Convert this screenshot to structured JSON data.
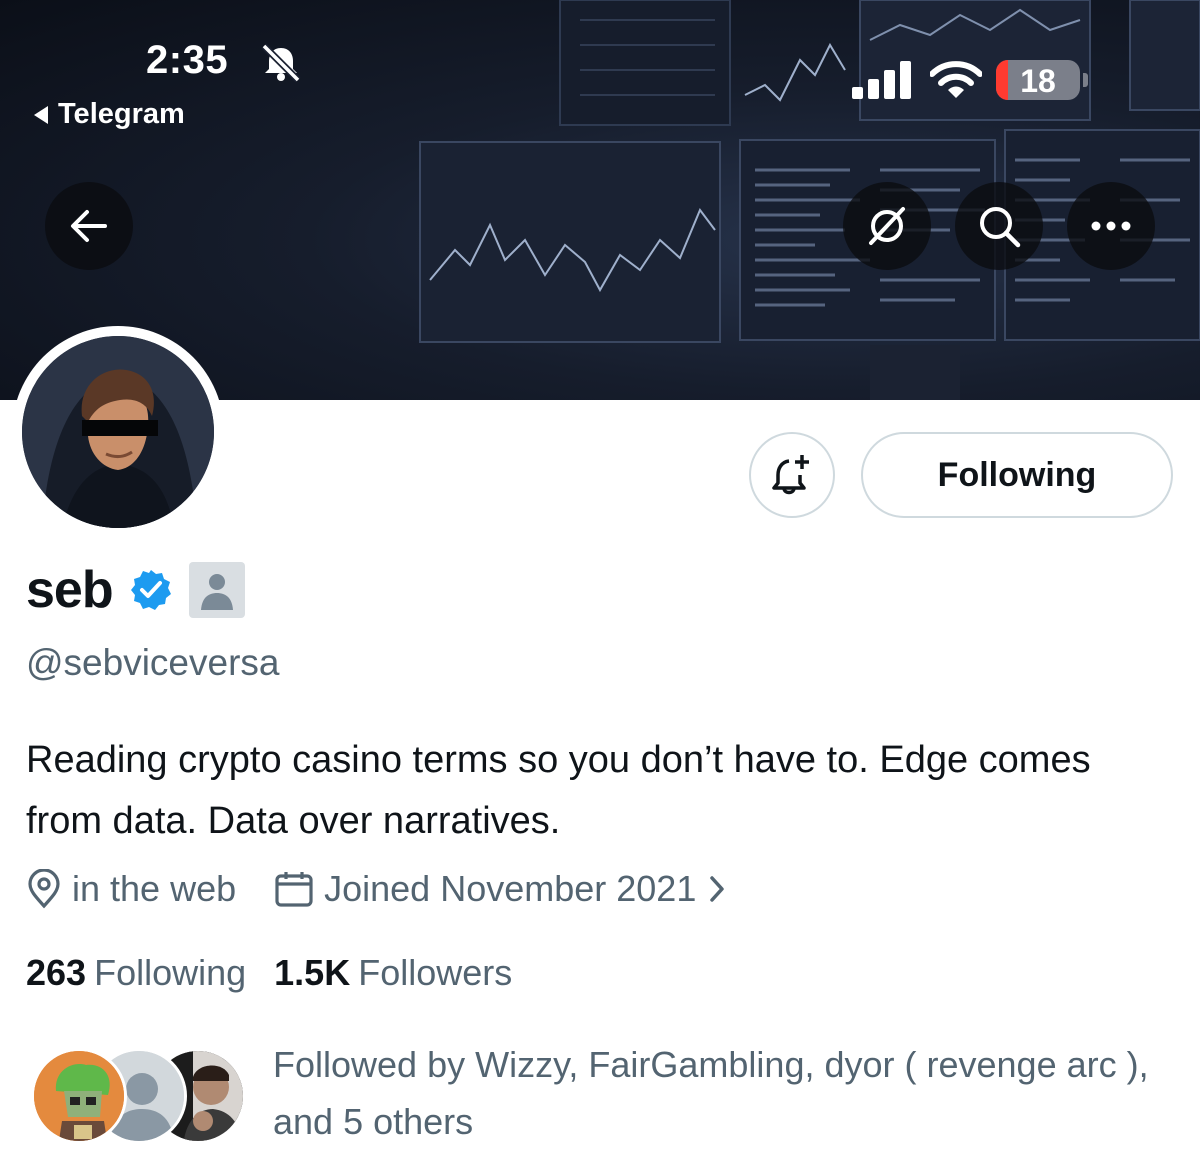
{
  "status_bar": {
    "time": "2:35",
    "back_app_label": "Telegram",
    "battery_percent": "18",
    "icons": [
      "bell-slash-icon",
      "cellular-signal-icon",
      "wifi-icon",
      "battery-icon"
    ]
  },
  "header": {
    "icons": [
      "back-arrow-icon",
      "grok-icon",
      "search-icon",
      "more-icon"
    ]
  },
  "profile": {
    "display_name": "seb",
    "handle": "@sebviceversa",
    "bio": "Reading crypto casino terms so you don’t have to. Edge comes from data. Data over narratives.",
    "location": "in the web",
    "joined": "Joined November 2021",
    "following_count": "263",
    "following_label": "Following",
    "followers_count": "1.5K",
    "followers_label": "Followers",
    "followed_by": "Followed by Wizzy, FairGambling, dyor ( revenge arc ), and 5 others",
    "verified_color": "#1d9bf0"
  },
  "actions": {
    "notify_icon": "bell-plus-icon",
    "following_button_label": "Following"
  },
  "colors": {
    "text_primary": "#0f1419",
    "text_secondary": "#536471",
    "battery_low": "#ff3b30"
  }
}
